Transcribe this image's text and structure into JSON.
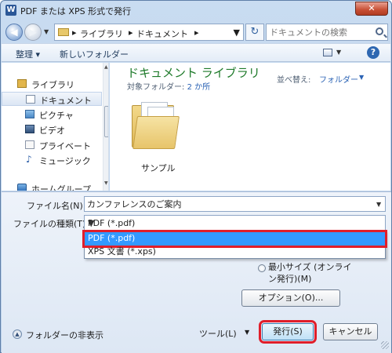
{
  "window": {
    "title": "PDF または XPS 形式で発行",
    "app_icon": "W",
    "close_label": "✕"
  },
  "navigation": {
    "breadcrumb": [
      "ライブラリ",
      "ドキュメント"
    ],
    "search_placeholder": "ドキュメントの検索"
  },
  "toolbar": {
    "organize": "整理 ▾",
    "new_folder": "新しいフォルダー"
  },
  "sidebar": {
    "items": [
      {
        "label": "ライブラリ",
        "icon": "library-icon"
      },
      {
        "label": "ドキュメント",
        "icon": "document-icon"
      },
      {
        "label": "ピクチャ",
        "icon": "picture-icon"
      },
      {
        "label": "ビデオ",
        "icon": "video-icon"
      },
      {
        "label": "プライベート",
        "icon": "private-icon"
      },
      {
        "label": "ミュージック",
        "icon": "music-icon"
      },
      {
        "label": "ホームグループ",
        "icon": "homegroup-icon"
      }
    ]
  },
  "content": {
    "library_title": "ドキュメント ライブラリ",
    "subtitle_prefix": "対象フォルダー: ",
    "subtitle_link": "2 か所",
    "sort_label": "並べ替え:",
    "sort_value": "フォルダー",
    "folders": [
      {
        "name": "サンプル"
      }
    ]
  },
  "form": {
    "filename_label": "ファイル名(N):",
    "filename_value": "カンファレンスのご案内",
    "filetype_label": "ファイルの種類(T):",
    "filetype_value": "PDF (*.pdf)",
    "filetype_options": [
      "PDF (*.pdf)",
      "XPS 文書 (*.xps)"
    ],
    "min_size_label": "最小サイズ (オンライン発行)(M)",
    "options_button": "オプション(O)...",
    "hide_folders": "フォルダーの非表示",
    "tools": "ツール(L)",
    "publish_button": "発行(S)",
    "cancel_button": "キャンセル"
  },
  "colors": {
    "accent_highlight": "#3399ff",
    "annotation_red": "#e01e2a",
    "library_title_green": "#1e7a2a"
  }
}
